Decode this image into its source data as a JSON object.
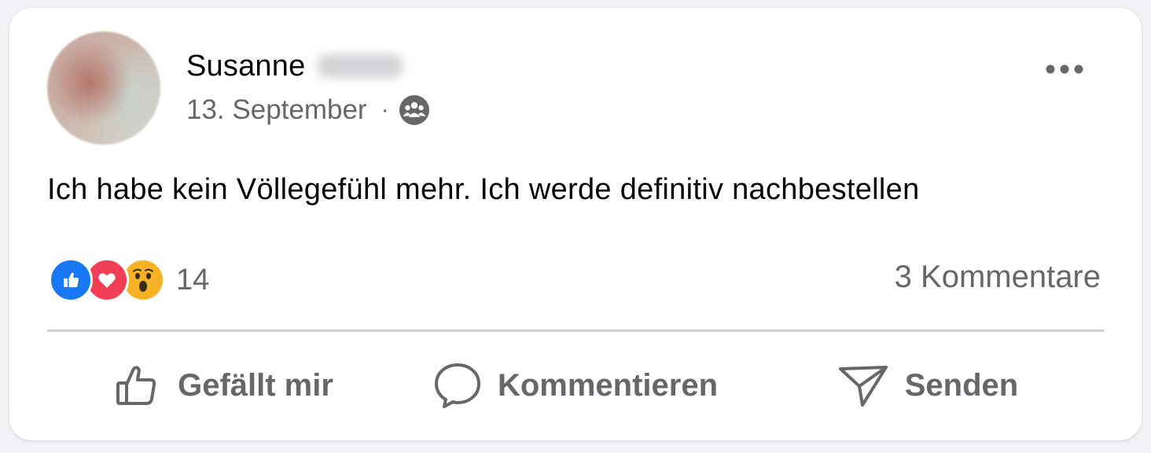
{
  "post": {
    "author_first_name": "Susanne",
    "date": "13. September",
    "separator": "·",
    "audience_icon": "group-icon",
    "text": "Ich habe kein Völlegefühl mehr. Ich werde definitiv nachbestellen"
  },
  "reactions": {
    "icons": [
      "like-reaction-icon",
      "love-reaction-icon",
      "wow-reaction-icon"
    ],
    "count": "14"
  },
  "comments": {
    "label": "3 Kommentare"
  },
  "actions": {
    "like_label": "Gefällt mir",
    "comment_label": "Kommentieren",
    "send_label": "Senden"
  },
  "colors": {
    "text_primary": "#050505",
    "text_secondary": "#65676b",
    "like_blue": "#1877f2",
    "love_red": "#f33e58",
    "wow_yellow": "#f7b125",
    "divider": "#ced0d4"
  }
}
